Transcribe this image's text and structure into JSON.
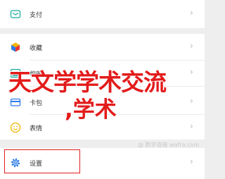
{
  "menu": {
    "items": [
      {
        "label": "支付",
        "icon": "wallet-icon"
      },
      {
        "label": "收藏",
        "icon": "cube-icon"
      },
      {
        "label": "相册",
        "icon": "image-icon"
      },
      {
        "label": "卡包",
        "icon": "card-icon"
      },
      {
        "label": "表情",
        "icon": "smiley-icon"
      },
      {
        "label": "设置",
        "icon": "gear-icon"
      }
    ],
    "chevron": "›"
  },
  "overlay": {
    "line1": "天文学学术交流",
    "line2": ",学术"
  },
  "watermark": "@ 数字连接 wafra.com",
  "colors": {
    "accent_red": "#e31b1b",
    "icon_teal": "#1aa99a"
  }
}
